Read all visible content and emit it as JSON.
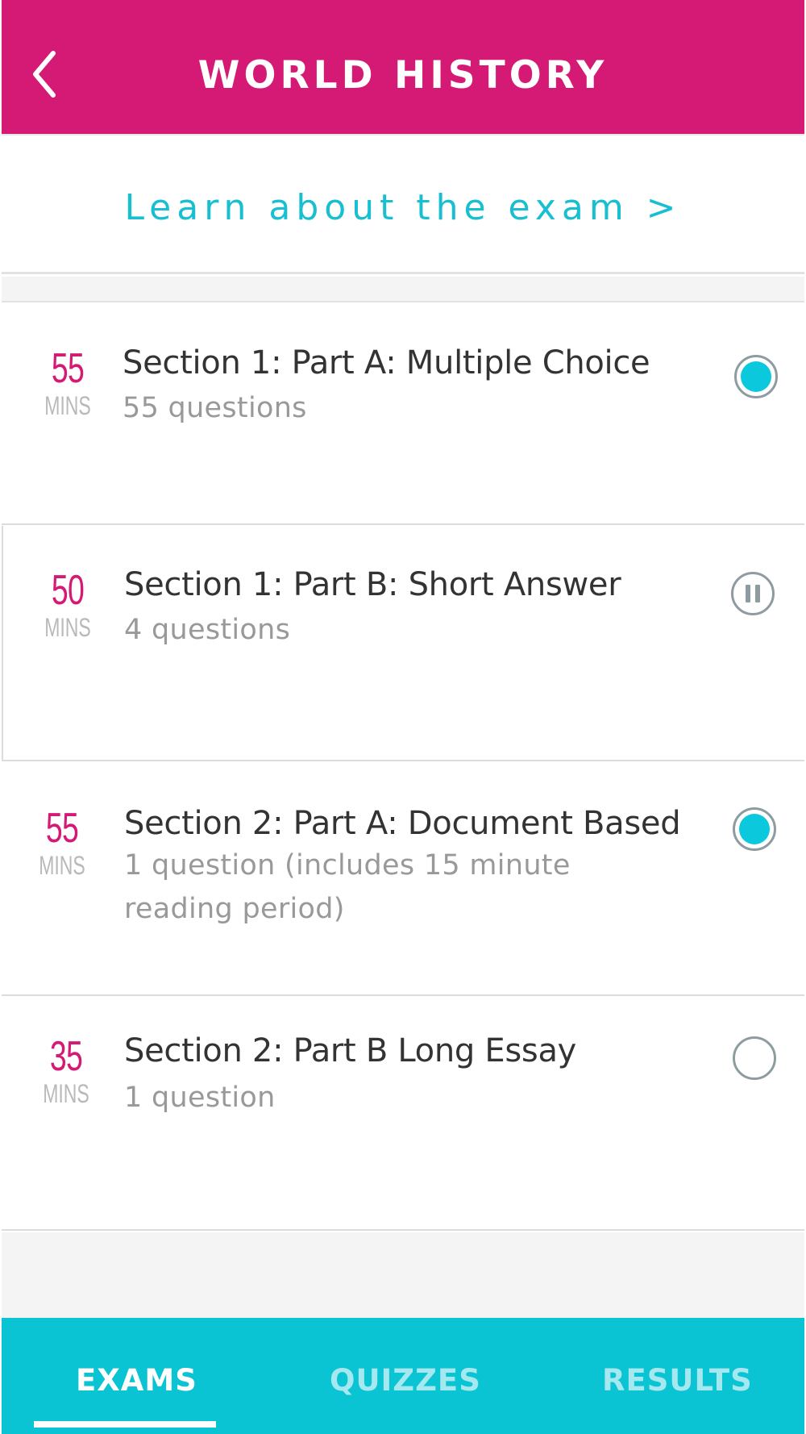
{
  "header": {
    "title": "WORLD HISTORY",
    "back_icon": "chevron-left-icon",
    "background_color": "#d41a74"
  },
  "learn_link": "Learn about the exam >",
  "sections": [
    {
      "minutes": "55",
      "unit": "MINS",
      "title": "Section 1: Part A: Multiple Choice",
      "subtitle": "55 questions",
      "status": "completed",
      "status_icon": "filled-circle-icon"
    },
    {
      "minutes": "50",
      "unit": "MINS",
      "title": "Section 1: Part B: Short Answer",
      "subtitle": "4 questions",
      "status": "paused",
      "status_icon": "pause-circle-icon"
    },
    {
      "minutes": "55",
      "unit": "MINS",
      "title": "Section 2: Part A: Document Based",
      "subtitle_lines": [
        "1 question (includes 15 minute",
        "reading period)"
      ],
      "status": "completed",
      "status_icon": "filled-circle-icon"
    },
    {
      "minutes": "35",
      "unit": "MINS",
      "title": "Section 2: Part B Long Essay",
      "subtitle": "1 question",
      "status": "not-started",
      "status_icon": "empty-circle-icon"
    }
  ],
  "tabs": [
    {
      "label": "EXAMS",
      "active": true
    },
    {
      "label": "QUIZZES",
      "active": false
    },
    {
      "label": "RESULTS",
      "active": false
    }
  ],
  "colors": {
    "accent": "#d41a74",
    "teal": "#0ac4d3",
    "link": "#17bfd0",
    "status_fill": "#0bc8dc"
  }
}
